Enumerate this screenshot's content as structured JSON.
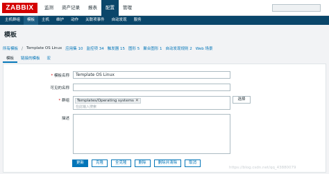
{
  "app": {
    "logo": "ZABBIX"
  },
  "top_menu": [
    {
      "label": "监测",
      "active": false
    },
    {
      "label": "资产记录",
      "active": false
    },
    {
      "label": "报表",
      "active": false
    },
    {
      "label": "配置",
      "active": true
    },
    {
      "label": "管理",
      "active": false
    }
  ],
  "sub_menu": [
    {
      "label": "主机群组",
      "active": false
    },
    {
      "label": "模板",
      "active": true
    },
    {
      "label": "主机",
      "active": false
    },
    {
      "label": "维护",
      "active": false
    },
    {
      "label": "动作",
      "active": false
    },
    {
      "label": "关联项事件",
      "active": false
    },
    {
      "label": "自动发现",
      "active": false
    },
    {
      "label": "服务",
      "active": false
    }
  ],
  "page": {
    "title": "模板"
  },
  "breadcrumbs": [
    {
      "label": "所有模板",
      "style": "link"
    },
    {
      "label": "Template OS Linux",
      "style": "current"
    },
    {
      "label": "应用集 10",
      "style": "link"
    },
    {
      "label": "监控项 34",
      "style": "link"
    },
    {
      "label": "触发器 15",
      "style": "link"
    },
    {
      "label": "图形 5",
      "style": "link"
    },
    {
      "label": "聚合图形 1",
      "style": "link"
    },
    {
      "label": "自动发现规则 2",
      "style": "link"
    },
    {
      "label": "Web 场景",
      "style": "link"
    }
  ],
  "tabs": [
    {
      "label": "模板",
      "active": true
    },
    {
      "label": "链接的模板",
      "active": false
    },
    {
      "label": "宏",
      "active": false
    }
  ],
  "form": {
    "template_name_label": "模板名称",
    "template_name_value": "Template OS Linux",
    "visible_name_label": "可见的名称",
    "visible_name_value": "",
    "groups_label": "群组",
    "groups_chip": "Templates/Operating systems",
    "groups_placeholder": "在此输入搜索",
    "select_button": "选择",
    "description_label": "描述",
    "description_value": ""
  },
  "actions": {
    "update": "更新",
    "clone": "克隆",
    "full_clone": "全克隆",
    "delete": "删除",
    "delete_and_clear": "删除并清除",
    "cancel": "取消"
  },
  "watermark": "https://blog.csdn.net/qq_43880079"
}
